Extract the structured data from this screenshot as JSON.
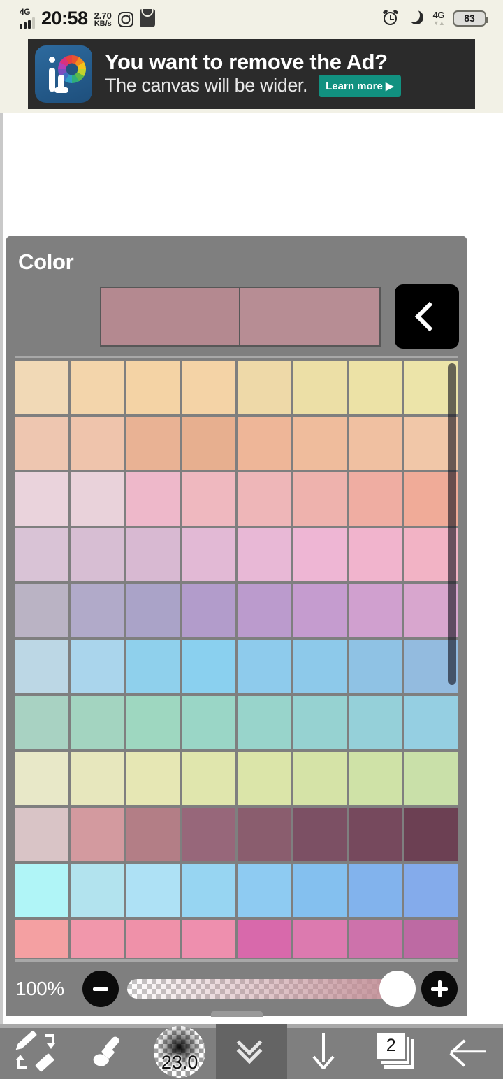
{
  "status_bar": {
    "network_type": "4G",
    "time": "20:58",
    "net_speed_value": "2.70",
    "net_speed_unit": "KB/s",
    "instagram_icon": "instagram-icon",
    "bag_icon": "shopping-bag-icon",
    "alarm_icon": "alarm-icon",
    "dnd_icon": "moon-icon",
    "network_type_right": "4G",
    "battery_percent": "83"
  },
  "ad": {
    "title": "You want to remove the Ad?",
    "subtitle": "The canvas will be wider.",
    "cta_label": "Learn more ▶",
    "logo_name": "ibispaint-logo",
    "bg_color": "#2b2b2b",
    "cta_color": "#119180"
  },
  "color_panel": {
    "title": "Color",
    "back_button_icon": "chevron-left-icon",
    "preview_current": "#b4899093",
    "preview_new": "#b48990",
    "preview_current_hex": "#b48990",
    "preview_new_hex": "#b78d94",
    "opacity_label": "100%",
    "opacity_value": 100,
    "minus_label": "−",
    "plus_label": "+",
    "panel_color": "#7f7f7f",
    "scrollbar_position": 0,
    "swatch_rows": [
      [
        "#f1d9b6",
        "#f3d5ab",
        "#f4d3a5",
        "#f4d3a6",
        "#eed9a8",
        "#ecdfa6",
        "#ece2a6",
        "#ece4a9"
      ],
      [
        "#eec6b0",
        "#efc4ac",
        "#e9b294",
        "#e7af8f",
        "#eeb698",
        "#efbc9c",
        "#f0c0a1",
        "#f1c7a8"
      ],
      [
        "#ead3dc",
        "#e9d2da",
        "#eeb8ca",
        "#efb8bf",
        "#eeb6b8",
        "#eeb2ad",
        "#efada2",
        "#f0ab98"
      ],
      [
        "#d9c3d6",
        "#d7bed3",
        "#d8b9d2",
        "#e2b9d5",
        "#e8b8d6",
        "#eeb6d4",
        "#f1b4cd",
        "#f2b3c5"
      ],
      [
        "#bab3c4",
        "#b1aac9",
        "#aaa3c8",
        "#b29ccb",
        "#bb9bcd",
        "#c59ccf",
        "#d0a0cf",
        "#d8a6ce"
      ],
      [
        "#bcd7e5",
        "#aad5ec",
        "#8fd0ec",
        "#8ad0ef",
        "#8ecbec",
        "#8dc9ea",
        "#8fc2e4",
        "#93bbdf"
      ],
      [
        "#a8d2c2",
        "#a3d4c0",
        "#9ed7c0",
        "#9ad6c6",
        "#98d4cb",
        "#96d2d1",
        "#95d0d9",
        "#95cfe2"
      ],
      [
        "#e8e8c8",
        "#e7e7bd",
        "#e6e7b4",
        "#e0e6ad",
        "#dbe5a9",
        "#d5e3a7",
        "#cfe2a7",
        "#c9e0a9"
      ],
      [
        "#d9c4c6",
        "#d39a9f",
        "#b37e86",
        "#97677a",
        "#8a5d6e",
        "#7c5064",
        "#76495d",
        "#6c4053"
      ],
      [
        "#b0f5f7",
        "#b2e3ee",
        "#aee1f5",
        "#97d5f2",
        "#8ecbf2",
        "#84c0ef",
        "#82b3ed",
        "#84abeb"
      ],
      [
        "#f4a0a2",
        "#f197ab",
        "#ef91a9",
        "#ee8fae",
        "#d869ab",
        "#dc7aaf",
        "#cd72ab",
        "#bd6aa3"
      ]
    ]
  },
  "toolbar": {
    "items": [
      {
        "name": "tool-swap-brush-eraser",
        "icon": "brush-eraser-swap-icon",
        "label": ""
      },
      {
        "name": "tool-brush",
        "icon": "brush-icon",
        "label": ""
      },
      {
        "name": "tool-brush-size",
        "icon": "brush-size-icon",
        "label": "23.0"
      },
      {
        "name": "tool-collapse-panel",
        "icon": "double-chevron-down-icon",
        "label": ""
      },
      {
        "name": "tool-download",
        "icon": "arrow-down-icon",
        "label": ""
      },
      {
        "name": "tool-layers",
        "icon": "layers-icon",
        "label": "2"
      },
      {
        "name": "tool-back",
        "icon": "arrow-left-icon",
        "label": ""
      }
    ],
    "active_index": 3,
    "brush_size": "23.0",
    "layer_count": "2"
  }
}
